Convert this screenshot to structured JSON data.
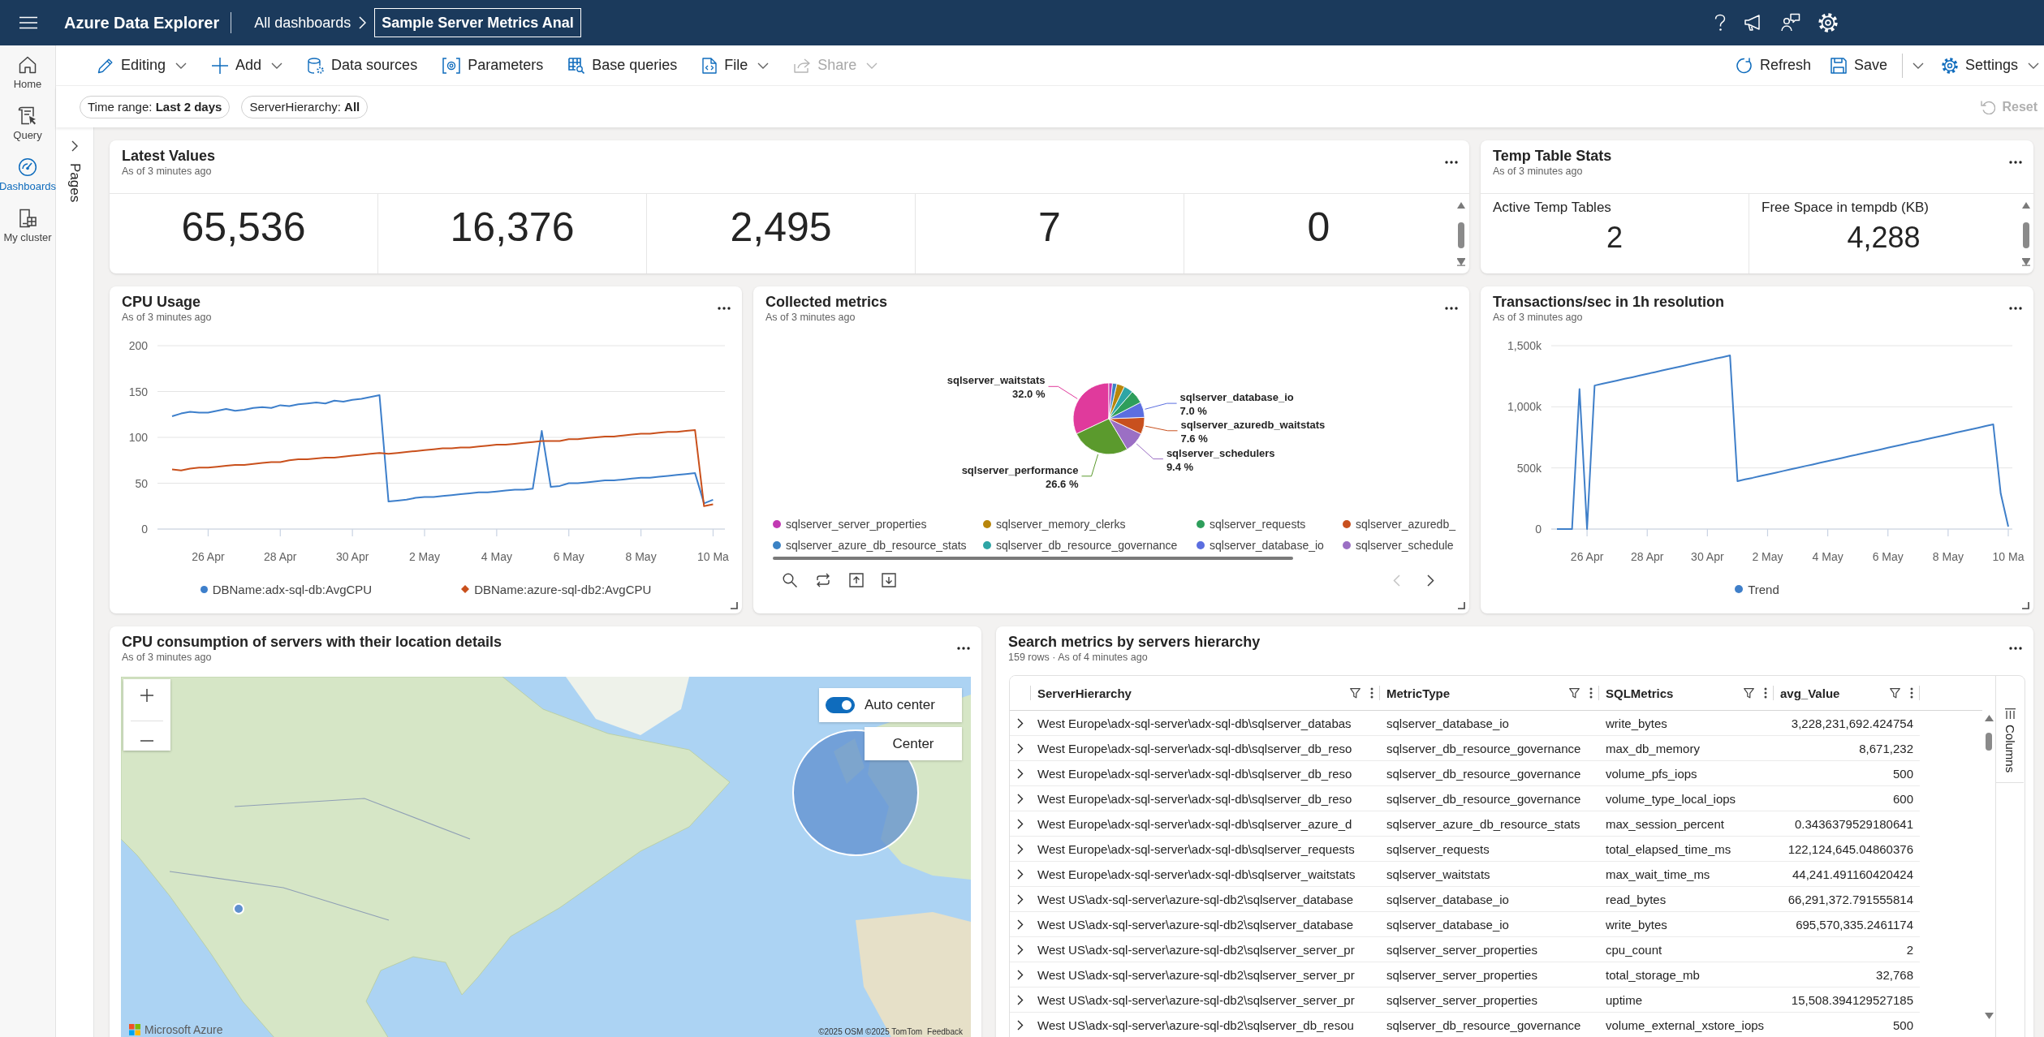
{
  "top_bar": {
    "app_title": "Azure Data Explorer",
    "breadcrumb": "All dashboards",
    "dashboard_name": "Sample Server Metrics Anal"
  },
  "nav_rail": [
    {
      "label": "Home",
      "selected": false
    },
    {
      "label": "Query",
      "selected": false
    },
    {
      "label": "Dashboards",
      "selected": true
    },
    {
      "label": "My cluster",
      "selected": false
    }
  ],
  "pages_panel": {
    "label": "Pages"
  },
  "toolbar": {
    "left": [
      {
        "label": "Editing",
        "dropdown": true,
        "disabled": false
      },
      {
        "label": "Add",
        "dropdown": true,
        "disabled": false
      },
      {
        "label": "Data sources",
        "dropdown": false,
        "disabled": false
      },
      {
        "label": "Parameters",
        "dropdown": false,
        "disabled": false
      },
      {
        "label": "Base queries",
        "dropdown": false,
        "disabled": false
      },
      {
        "label": "File",
        "dropdown": true,
        "disabled": false
      },
      {
        "label": "Share",
        "dropdown": true,
        "disabled": true
      }
    ],
    "right": [
      {
        "label": "Refresh",
        "dropdown": false,
        "split": false
      },
      {
        "label": "Save",
        "dropdown": false,
        "split": true
      },
      {
        "label": "Settings",
        "dropdown": true,
        "split": false
      }
    ]
  },
  "parameters": {
    "pills": [
      "Time range: **Last 2 days**",
      "ServerHierarchy: **All**"
    ],
    "reset": {
      "label": "Reset",
      "disabled": true
    }
  },
  "latest_values": {
    "title": "Latest Values",
    "subtitle": "As of 3 minutes ago",
    "values": [
      "65,536",
      "16,376",
      "2,495",
      "7",
      "0"
    ]
  },
  "temp_table_stats": {
    "title": "Temp Table Stats",
    "subtitle": "As of 3 minutes ago",
    "stats": [
      {
        "label": "Active Temp Tables",
        "value": "2"
      },
      {
        "label": "Free Space in tempdb (KB)",
        "value": "4,288"
      }
    ]
  },
  "cpu_usage": {
    "title": "CPU Usage",
    "subtitle": "As of 3 minutes ago",
    "chart_data": {
      "type": "line",
      "grid": true,
      "categories": [
        null,
        null,
        null,
        null,
        "26 Apr",
        null,
        null,
        null,
        null,
        null,
        null,
        null,
        "28 Apr",
        null,
        null,
        null,
        null,
        null,
        null,
        null,
        "30 Apr",
        null,
        null,
        null,
        null,
        null,
        null,
        null,
        "2 May",
        null,
        null,
        null,
        null,
        null,
        null,
        null,
        "4 May",
        null,
        null,
        null,
        null,
        null,
        null,
        null,
        "6 May",
        null,
        null,
        null,
        null,
        null,
        null,
        null,
        "8 May",
        null,
        null,
        null,
        null,
        null,
        null,
        null,
        "10 Ma"
      ],
      "series": [
        {
          "name": "DBName:adx-sql-db:AvgCPU",
          "color": "#3d7fcb",
          "values": [
            123,
            126,
            128,
            127,
            127,
            129,
            131,
            129,
            130,
            132,
            133,
            132,
            135,
            134,
            136,
            137,
            138,
            137,
            140,
            139,
            141,
            142,
            144,
            146,
            30,
            31,
            32,
            34,
            35,
            35,
            36,
            37,
            38,
            39,
            40,
            40,
            41,
            42,
            43,
            43,
            44,
            107,
            46,
            47,
            50,
            50,
            51,
            52,
            53,
            53,
            54,
            55,
            56,
            56,
            57,
            58,
            59,
            60,
            61,
            28,
            32
          ]
        },
        {
          "name": "DBName:azure-sql-db2:AvgCPU",
          "color": "#c9501c",
          "values": [
            65,
            64,
            66,
            67,
            67,
            68,
            69,
            70,
            70,
            71,
            72,
            73,
            73,
            75,
            76,
            76,
            77,
            78,
            78,
            79,
            80,
            81,
            82,
            83,
            82,
            83,
            84,
            85,
            86,
            87,
            88,
            88,
            89,
            89,
            90,
            91,
            92,
            92,
            93,
            94,
            95,
            96,
            96,
            96,
            98,
            98,
            99,
            100,
            101,
            101,
            102,
            103,
            104,
            104,
            105,
            106,
            106,
            107,
            108,
            25,
            27
          ]
        }
      ],
      "ylim": [
        0,
        200
      ],
      "yticks": [
        0,
        50,
        100,
        150,
        200
      ]
    }
  },
  "collected_metrics": {
    "title": "Collected metrics",
    "subtitle": "As of 3 minutes ago",
    "chart_data": {
      "type": "pie",
      "categories": [
        "sqlserver_waitstats",
        "sqlserver_performance",
        "sqlserver_schedulers",
        "sqlserver_azuredb_waitstats",
        "sqlserver_database_io",
        null,
        null,
        null,
        null,
        null
      ],
      "values": [
        32.0,
        26.6,
        9.4,
        7.6,
        7.0,
        6.0,
        4.2,
        3.6,
        2.0,
        1.6
      ],
      "colors": [
        "#e03a9c",
        "#5b9a2d",
        "#9b6fc4",
        "#c8501e",
        "#5b6ee0",
        "#2e9e5b",
        "#2ea5a5",
        "#b8860b",
        "#3b82c4",
        "#c239b3"
      ],
      "value_labels": [
        "32.0 %",
        "26.6 %",
        "9.4 %",
        "7.6 %",
        "7.0 %",
        null,
        null,
        null,
        null,
        null
      ]
    },
    "legend": [
      {
        "label": "sqlserver_server_properties",
        "color": "#c239b3"
      },
      {
        "label": "sqlserver_memory_clerks",
        "color": "#b8860b"
      },
      {
        "label": "sqlserver_requests",
        "color": "#2e9e5b"
      },
      {
        "label": "sqlserver_azuredb_",
        "color": "#c8501e"
      },
      {
        "label": "sqlserver_azure_db_resource_stats",
        "color": "#3b82c4"
      },
      {
        "label": "sqlserver_db_resource_governance",
        "color": "#2ea5a5"
      },
      {
        "label": "sqlserver_database_io",
        "color": "#5b6ee0"
      },
      {
        "label": "sqlserver_schedule",
        "color": "#9b6fc4"
      }
    ],
    "pager": {
      "previous_disabled": true,
      "next_disabled": false
    }
  },
  "transactions": {
    "title": "Transactions/sec in 1h resolution",
    "subtitle": "As of 3 minutes ago",
    "chart_data": {
      "type": "line",
      "grid": true,
      "categories": [
        null,
        null,
        null,
        null,
        "26 Apr",
        null,
        null,
        null,
        null,
        null,
        null,
        null,
        "28 Apr",
        null,
        null,
        null,
        null,
        null,
        null,
        null,
        "30 Apr",
        null,
        null,
        null,
        null,
        null,
        null,
        null,
        "2 May",
        null,
        null,
        null,
        null,
        null,
        null,
        null,
        "4 May",
        null,
        null,
        null,
        null,
        null,
        null,
        null,
        "6 May",
        null,
        null,
        null,
        null,
        null,
        null,
        null,
        "8 May",
        null,
        null,
        null,
        null,
        null,
        null,
        null,
        "10 Ma"
      ],
      "series": [
        {
          "name": "Trend",
          "color": "#3f7fc9",
          "values": [
            0,
            0,
            0,
            1145000,
            0,
            1174000,
            1188000,
            1201000,
            1215000,
            1229000,
            1242000,
            1256000,
            1270000,
            1283000,
            1297000,
            1311000,
            1324000,
            1338000,
            1352000,
            1365000,
            1379000,
            1393000,
            1406000,
            1420000,
            392000,
            406000,
            419000,
            433000,
            447000,
            460000,
            474000,
            488000,
            501000,
            515000,
            528000,
            542000,
            556000,
            569000,
            583000,
            597000,
            610000,
            624000,
            638000,
            651000,
            665000,
            678000,
            692000,
            706000,
            719000,
            733000,
            747000,
            760000,
            774000,
            788000,
            801000,
            815000,
            828000,
            842000,
            856000,
            290000,
            20000
          ]
        }
      ],
      "ylim": [
        0,
        1500000
      ],
      "yticks": [
        {
          "value": 0,
          "label": "0"
        },
        {
          "value": 500000,
          "label": "500k"
        },
        {
          "value": 1000000,
          "label": "1,000k"
        },
        {
          "value": 1500000,
          "label": "1,500k"
        }
      ]
    }
  },
  "cpu_map": {
    "title": "CPU consumption of servers with their location details",
    "subtitle": "As of 3 minutes ago",
    "auto_center": {
      "label": "Auto center",
      "on": true
    },
    "center_button": "Center",
    "logo": "Microsoft Azure",
    "attribution": "©2025 OSM  ©2025 TomTom",
    "feedback_link": "Feedback"
  },
  "search_metrics": {
    "title": "Search metrics by servers hierarchy",
    "meta": "159 rows · As of 4 minutes ago",
    "columns": [
      "ServerHierarchy",
      "MetricType",
      "SQLMetrics",
      "avg_Value"
    ],
    "rows": [
      {
        "expanded": false,
        "cells": [
          "West Europe\\adx-sql-server\\adx-sql-db\\sqlserver_databas",
          "sqlserver_database_io",
          "write_bytes",
          "3,228,231,692.424754"
        ]
      },
      {
        "expanded": false,
        "cells": [
          "West Europe\\adx-sql-server\\adx-sql-db\\sqlserver_db_reso",
          "sqlserver_db_resource_governance",
          "max_db_memory",
          "8,671,232"
        ]
      },
      {
        "expanded": false,
        "cells": [
          "West Europe\\adx-sql-server\\adx-sql-db\\sqlserver_db_reso",
          "sqlserver_db_resource_governance",
          "volume_pfs_iops",
          "500"
        ]
      },
      {
        "expanded": false,
        "cells": [
          "West Europe\\adx-sql-server\\adx-sql-db\\sqlserver_db_reso",
          "sqlserver_db_resource_governance",
          "volume_type_local_iops",
          "600"
        ]
      },
      {
        "expanded": false,
        "cells": [
          "West Europe\\adx-sql-server\\adx-sql-db\\sqlserver_azure_d",
          "sqlserver_azure_db_resource_stats",
          "max_session_percent",
          "0.3436379529180641"
        ]
      },
      {
        "expanded": false,
        "cells": [
          "West Europe\\adx-sql-server\\adx-sql-db\\sqlserver_requests",
          "sqlserver_requests",
          "total_elapsed_time_ms",
          "122,124,645.04860376"
        ]
      },
      {
        "expanded": false,
        "cells": [
          "West Europe\\adx-sql-server\\adx-sql-db\\sqlserver_waitstats",
          "sqlserver_waitstats",
          "max_wait_time_ms",
          "44,241.491160420424"
        ]
      },
      {
        "expanded": false,
        "cells": [
          "West US\\adx-sql-server\\azure-sql-db2\\sqlserver_database",
          "sqlserver_database_io",
          "read_bytes",
          "66,291,372.791555814"
        ]
      },
      {
        "expanded": false,
        "cells": [
          "West US\\adx-sql-server\\azure-sql-db2\\sqlserver_database",
          "sqlserver_database_io",
          "write_bytes",
          "695,570,335.2461174"
        ]
      },
      {
        "expanded": false,
        "cells": [
          "West US\\adx-sql-server\\azure-sql-db2\\sqlserver_server_pr",
          "sqlserver_server_properties",
          "cpu_count",
          "2"
        ]
      },
      {
        "expanded": false,
        "cells": [
          "West US\\adx-sql-server\\azure-sql-db2\\sqlserver_server_pr",
          "sqlserver_server_properties",
          "total_storage_mb",
          "32,768"
        ]
      },
      {
        "expanded": false,
        "cells": [
          "West US\\adx-sql-server\\azure-sql-db2\\sqlserver_server_pr",
          "sqlserver_server_properties",
          "uptime",
          "15,508.394129527185"
        ]
      },
      {
        "expanded": false,
        "cells": [
          "West US\\adx-sql-server\\azure-sql-db2\\sqlserver_db_resou",
          "sqlserver_db_resource_governance",
          "volume_external_xstore_iops",
          "500"
        ]
      }
    ],
    "side_panel": "Columns"
  }
}
